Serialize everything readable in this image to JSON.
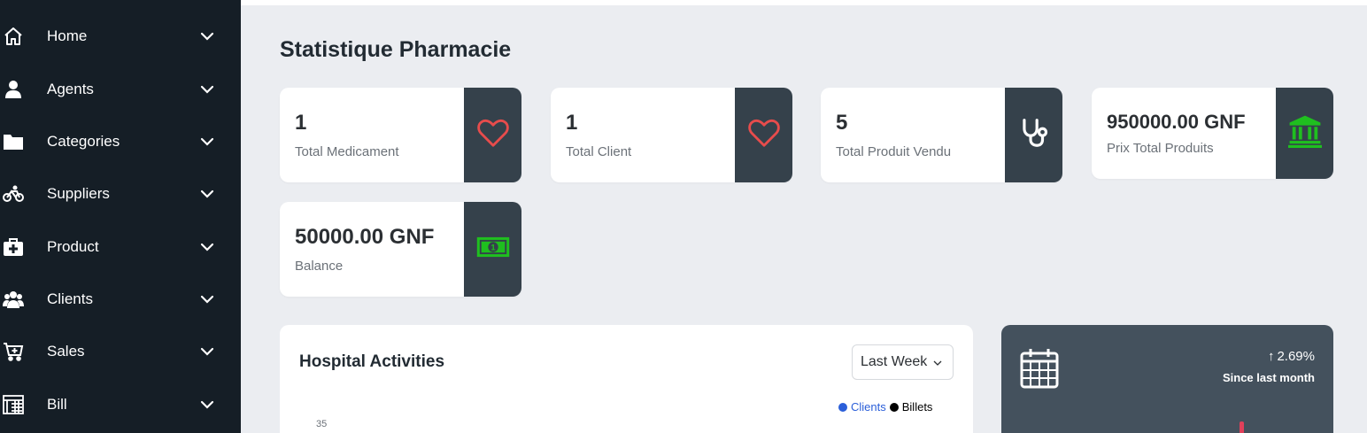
{
  "sidebar": {
    "items": [
      {
        "label": "Home",
        "icon": "home-icon"
      },
      {
        "label": "Agents",
        "icon": "user-icon"
      },
      {
        "label": "Categories",
        "icon": "folder-icon"
      },
      {
        "label": "Suppliers",
        "icon": "bicycle-icon"
      },
      {
        "label": "Product",
        "icon": "medical-kit-icon"
      },
      {
        "label": "Clients",
        "icon": "users-icon"
      },
      {
        "label": "Sales",
        "icon": "cart-plus-icon"
      },
      {
        "label": "Bill",
        "icon": "calculator-icon"
      }
    ]
  },
  "main": {
    "title": "Statistique Pharmacie",
    "cards": [
      {
        "value": "1",
        "label": "Total Medicament",
        "icon": "heart-icon",
        "icon_color": "#e74c4c"
      },
      {
        "value": "1",
        "label": "Total Client",
        "icon": "heart-icon",
        "icon_color": "#e74c4c"
      },
      {
        "value": "5",
        "label": "Total Produit Vendu",
        "icon": "stethoscope-icon",
        "icon_color": "#ffffff"
      },
      {
        "value": "950000.00 GNF",
        "label": "Prix Total Produits",
        "icon": "bank-icon",
        "icon_color": "#1fbf1f"
      },
      {
        "value": "50000.00 GNF",
        "label": "Balance",
        "icon": "money-bill-icon",
        "icon_color": "#1fbf1f"
      }
    ]
  },
  "activity": {
    "title": "Hospital Activities",
    "period": "Last Week",
    "legend": [
      {
        "name": "Clients",
        "color": "#2b5fd9"
      },
      {
        "name": "Billets",
        "color": "#000000"
      }
    ],
    "y_tick_top": "35"
  },
  "stat_panel": {
    "change": "2.69%",
    "since": "Since last month",
    "icon": "calendar-icon"
  },
  "colors": {
    "sidebar_bg": "#151e26",
    "card_side_bg": "#35414b",
    "panel_bg": "#44515d",
    "page_bg": "#ebedf1"
  }
}
